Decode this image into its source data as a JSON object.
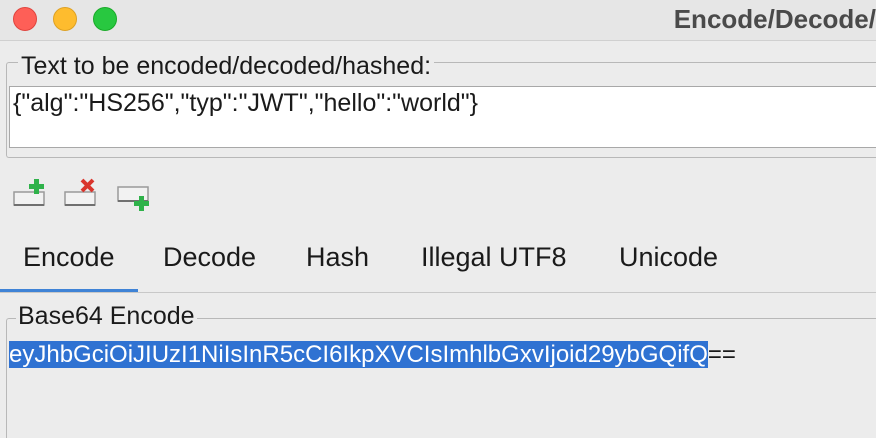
{
  "window": {
    "title": "Encode/Decode/"
  },
  "input": {
    "legend": "Text to be encoded/decoded/hashed:",
    "value": "{\"alg\":\"HS256\",\"typ\":\"JWT\",\"hello\":\"world\"}"
  },
  "toolbar": {
    "icons": [
      "add-icon",
      "remove-icon",
      "add-list-icon"
    ]
  },
  "tabs": [
    {
      "label": "Encode",
      "active": true
    },
    {
      "label": "Decode",
      "active": false
    },
    {
      "label": "Hash",
      "active": false
    },
    {
      "label": "Illegal UTF8",
      "active": false
    },
    {
      "label": "Unicode",
      "active": false
    }
  ],
  "output": {
    "legend": "Base64 Encode",
    "selected_text": "eyJhbGciOiJIUzI1NiIsInR5cCI6IkpXVCIsImhlbGxvIjoid29ybGQifQ",
    "rest_text": "=="
  },
  "colors": {
    "accent": "#3f83d6",
    "selection": "#2f72d2",
    "close": "#fe5f57",
    "minimize": "#febc2e",
    "zoom": "#28c840"
  }
}
